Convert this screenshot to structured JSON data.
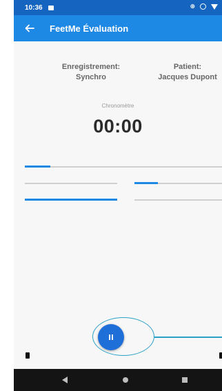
{
  "status_bar": {
    "time": "10:36",
    "icons": [
      "message-icon",
      "cast-icon",
      "circle-icon",
      "wifi-icon"
    ]
  },
  "app_bar": {
    "back_icon": "arrow-left-icon",
    "title": "FeetMe Évaluation"
  },
  "session": {
    "recording_label": "Enregistrement:",
    "recording_value": "Synchro",
    "patient_label": "Patient:",
    "patient_value": "Jacques Dupont"
  },
  "timer": {
    "label": "Chronomètre",
    "value": "00:00"
  },
  "progress": {
    "main_fill": 0.13,
    "left_top_fill": 0,
    "right_top_fill": 0.27,
    "left_bottom_fill": 1.0,
    "right_bottom_fill": 0
  },
  "controls": {
    "pause_icon": "pause-icon"
  },
  "colors": {
    "accent": "#1e88e5",
    "status_bar": "#1565c0",
    "highlight": "#2aa0c4"
  },
  "nav_bar": {
    "icons": [
      "back-triangle-icon",
      "home-circle-icon",
      "recents-square-icon"
    ]
  }
}
